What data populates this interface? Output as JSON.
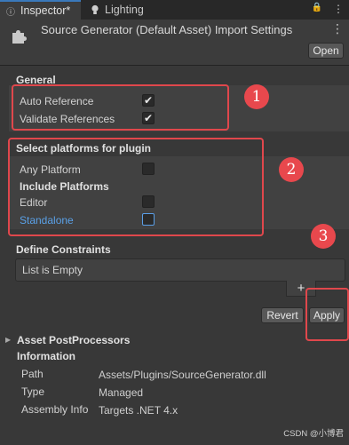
{
  "tabs": {
    "inspector": "Inspector*",
    "lighting": "Lighting"
  },
  "tab_icons": {
    "lock": "🔒",
    "menu": "⋮"
  },
  "header": {
    "title": "Source Generator (Default Asset) Import Settings",
    "open_label": "Open",
    "menu": "⋮"
  },
  "general": {
    "title": "General",
    "auto_reference": {
      "label": "Auto Reference",
      "checked": true,
      "mark": "✔"
    },
    "validate_references": {
      "label": "Validate References",
      "checked": true,
      "mark": "✔"
    }
  },
  "platforms": {
    "title": "Select platforms for plugin",
    "any_platform": {
      "label": "Any Platform",
      "checked": false
    },
    "include_title": "Include Platforms",
    "editor": {
      "label": "Editor",
      "checked": false
    },
    "standalone": {
      "label": "Standalone",
      "checked": false
    }
  },
  "constraints": {
    "title": "Define Constraints",
    "empty_text": "List is Empty",
    "add_symbol": "+"
  },
  "actions": {
    "revert": "Revert",
    "apply": "Apply"
  },
  "postprocessors": {
    "title": "Asset PostProcessors"
  },
  "information": {
    "title": "Information",
    "rows": [
      {
        "key": "Path",
        "value": "Assets/Plugins/SourceGenerator.dll"
      },
      {
        "key": "Type",
        "value": "Managed"
      },
      {
        "key": "Assembly Info",
        "value": "Targets .NET 4.x"
      }
    ]
  },
  "annotations": {
    "badge1": "1",
    "badge2": "2",
    "badge3": "3"
  },
  "watermark": "CSDN @小博君",
  "colors": {
    "highlight": "#e0474c",
    "link": "#5aa0e6",
    "panel": "#383838"
  }
}
